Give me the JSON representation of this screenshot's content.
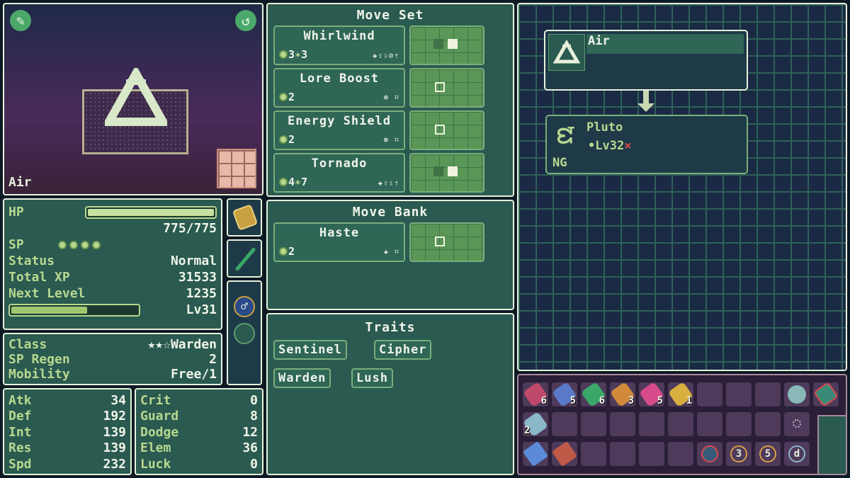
{
  "portrait": {
    "name": "Air",
    "wrench_icon": "wrench-icon",
    "undo_icon": "undo-icon"
  },
  "stats": {
    "hp_label": "HP",
    "hp_value": "775/775",
    "hp_fraction": 1.0,
    "sp_label": "SP",
    "sp_pips": 4,
    "status_label": "Status",
    "status_value": "Normal",
    "total_xp_label": "Total XP",
    "total_xp_value": "31533",
    "next_level_label": "Next Level",
    "next_level_value": "1235",
    "xp_fraction": 0.6,
    "level": "Lv31"
  },
  "class_info": {
    "class_label": "Class",
    "class_value": "★★☆Warden",
    "sp_regen_label": "SP Regen",
    "sp_regen_value": "2",
    "mobility_label": "Mobility",
    "mobility_value": "Free/1"
  },
  "attributes_left": [
    {
      "label": "Atk",
      "value": "34"
    },
    {
      "label": "Def",
      "value": "192"
    },
    {
      "label": "Int",
      "value": "139"
    },
    {
      "label": "Res",
      "value": "139"
    },
    {
      "label": "Spd",
      "value": "232"
    }
  ],
  "attributes_right": [
    {
      "label": "Crit",
      "value": "0"
    },
    {
      "label": "Guard",
      "value": "8"
    },
    {
      "label": "Dodge",
      "value": "12"
    },
    {
      "label": "Elem",
      "value": "36"
    },
    {
      "label": "Luck",
      "value": "0"
    }
  ],
  "move_set": {
    "title": "Move Set",
    "moves": [
      {
        "name": "Whirlwind",
        "cost": "3",
        "cost2": "3",
        "tags": "✚⇧⇩⊘⇡"
      },
      {
        "name": "Lore Boost",
        "cost": "2",
        "cost2": "",
        "tags": "⊗ ⌗"
      },
      {
        "name": "Energy Shield",
        "cost": "2",
        "cost2": "",
        "tags": "⊗ ⌗"
      },
      {
        "name": "Tornado",
        "cost": "4",
        "cost2": "7",
        "tags": "✚⇧⇩⇡"
      }
    ]
  },
  "move_bank": {
    "title": "Move Bank",
    "moves": [
      {
        "name": "Haste",
        "cost": "2",
        "tags": "✚ ⌗"
      }
    ]
  },
  "traits": {
    "title": "Traits",
    "items": [
      "Sentinel",
      "Cipher",
      "Warden",
      "Lush"
    ]
  },
  "evolution": {
    "from_name": "Air",
    "to_name": "Pluto",
    "to_level": "•Lv32",
    "to_level_mark": "×",
    "to_tag": "NG"
  },
  "inventory": {
    "row1": [
      {
        "icon": "potion-red-icon",
        "count": "6",
        "color": "#c0486a"
      },
      {
        "icon": "potion-blue-icon",
        "count": "5",
        "color": "#5a7ac8"
      },
      {
        "icon": "potion-green-icon",
        "count": "6",
        "color": "#3aa868"
      },
      {
        "icon": "potion-orange-icon",
        "count": "3",
        "color": "#d08a3a"
      },
      {
        "icon": "potion-pink-icon",
        "count": "5",
        "color": "#d84a8a"
      },
      {
        "icon": "potion-gold-icon",
        "count": "1",
        "color": "#d8b040"
      }
    ],
    "row2": [
      {
        "icon": "bandage-icon",
        "count": "2",
        "color": "#8ab8c8"
      }
    ],
    "row3": [
      {
        "icon": "book-blue-icon",
        "count": "",
        "color": "#5a8ad8"
      },
      {
        "icon": "book-red-icon",
        "count": "",
        "color": "#c05a48"
      }
    ],
    "special": [
      "3",
      "5",
      "d"
    ]
  },
  "colors": {
    "accent": "#b8d890",
    "panel": "#2a5a50",
    "bg": "#0d1a24",
    "inventory_bg": "#4e3a5a"
  }
}
